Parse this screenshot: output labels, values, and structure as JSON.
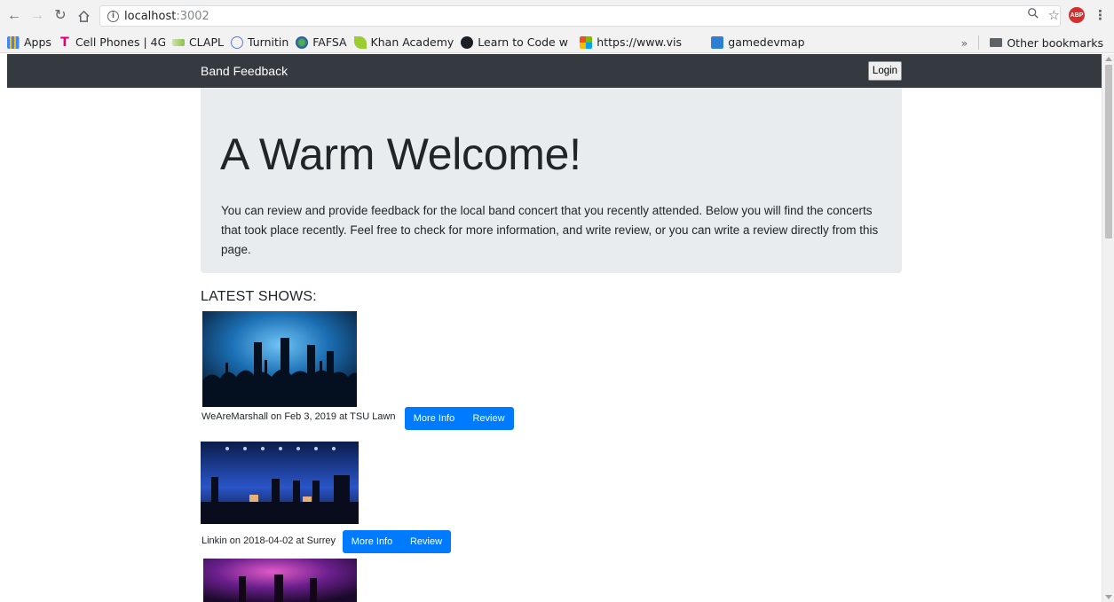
{
  "browser": {
    "url_host": "localhost",
    "url_port": ":3002",
    "bookmarks": [
      {
        "label": "Apps",
        "icon": "apps-grid-icon",
        "color": "#4285f4"
      },
      {
        "label": "Cell Phones | 4G",
        "icon": "tmobile-logo-icon",
        "color": "#e20074"
      },
      {
        "label": "CLAPL",
        "icon": "clapl-icon",
        "color": "#8bc34a"
      },
      {
        "label": "Turnitin",
        "icon": "turnitin-icon",
        "color": "#5b7bd5"
      },
      {
        "label": "FAFSA",
        "icon": "fafsa-globe-icon",
        "color": "#2a5aa8"
      },
      {
        "label": "Khan Academy",
        "icon": "khan-academy-leaf-icon",
        "color": "#9acd32"
      },
      {
        "label": "Learn to Code w",
        "icon": "github-icon",
        "color": "#1b1f23"
      },
      {
        "label": "https://www.vis",
        "icon": "microsoft-logo-icon",
        "color": "#f25022"
      },
      {
        "label": "gamedevmap",
        "icon": "gamedevmap-icon",
        "color": "#2d7fd3"
      }
    ],
    "overflow_label": "»",
    "other_bookmarks": "Other bookmarks"
  },
  "navbar": {
    "brand": "Band Feedback",
    "login_label": "Login"
  },
  "jumbotron": {
    "title": "A Warm Welcome!",
    "text": "You can review and provide feedback for the local band concert that you recently attended. Below you will find the concerts that took place recently. Feel free to check for more information, and write review, or you can write a review directly from this page."
  },
  "shows_heading": "LATEST SHOWS:",
  "shows": [
    {
      "caption": "WeAreMarshall on Feb 3, 2019 at TSU Lawn",
      "more_info": "More Info",
      "review": "Review"
    },
    {
      "caption": "Linkin on 2018-04-02 at Surrey",
      "more_info": "More Info",
      "review": "Review"
    }
  ],
  "colors": {
    "navbar_bg": "#343a40",
    "jumbotron_bg": "#e9ecef",
    "primary": "#007bff"
  }
}
